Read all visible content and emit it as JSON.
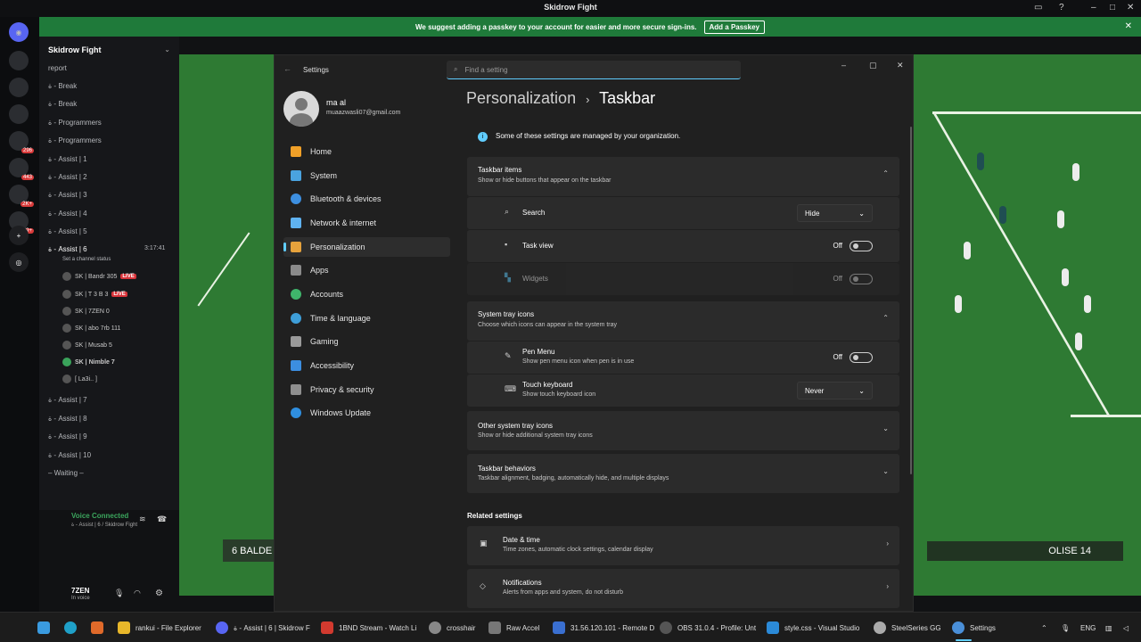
{
  "topbar": {
    "title": "Skidrow Fight"
  },
  "banner": {
    "text": "We suggest adding a passkey to your account for easier and more secure sign-ins.",
    "button": "Add a Passkey"
  },
  "servers": [
    {
      "badge": ""
    },
    {
      "badge": ""
    },
    {
      "badge": ""
    },
    {
      "badge": ""
    },
    {
      "badge": "296"
    },
    {
      "badge": "443"
    },
    {
      "badge": "2K+"
    },
    {
      "badge": "99+"
    }
  ],
  "channels": {
    "server_name": "Skidrow Fight",
    "items": [
      "report",
      "ة - Break",
      "ة - Break",
      "ة - Programmers",
      "ة - Programmers",
      "ة - Assist | 1",
      "ة - Assist | 2",
      "ة - Assist | 3",
      "ة - Assist | 4",
      "ة - Assist | 5"
    ],
    "active": {
      "label": "ة - Assist | 6",
      "time": "3:17:41",
      "status": "Set a channel status"
    },
    "voice_users": [
      {
        "name": "SK | Bandr 305",
        "live": "LIVE"
      },
      {
        "name": "SK | T 3 B 3",
        "live": "LIVE"
      },
      {
        "name": "SK | 7ZEN 0",
        "live": ""
      },
      {
        "name": "SK | abo 7rb 111",
        "live": ""
      },
      {
        "name": "SK | Musab 5",
        "live": ""
      },
      {
        "name": "SK | Nimble 7",
        "live": ""
      },
      {
        "name": "[ La3i.. ]",
        "live": ""
      }
    ],
    "more": [
      "ة - Assist | 7",
      "ة - Assist | 8",
      "ة - Assist | 9",
      "ة - Assist | 10",
      "– Waiting –"
    ]
  },
  "voice": {
    "status": "Voice Connected",
    "channel": "ة - Assist | 6 / Skidrow Fight",
    "user": "7ZEN",
    "user_status": "In voice"
  },
  "game": {
    "left_hud": "6  BALDE",
    "right_hud": "OLISE 14"
  },
  "settings": {
    "window_title": "Settings",
    "search_placeholder": "Find a setting",
    "profile": {
      "name": "ma al",
      "email": "muaazwasli07@gmail.com"
    },
    "nav": [
      {
        "label": "Home",
        "color": "#f0a028"
      },
      {
        "label": "System",
        "color": "#4aa3df"
      },
      {
        "label": "Bluetooth & devices",
        "color": "#3d8fe0"
      },
      {
        "label": "Network & internet",
        "color": "#5fb2f0"
      },
      {
        "label": "Personalization",
        "color": "#e6a23c"
      },
      {
        "label": "Apps",
        "color": "#8a8a8a"
      },
      {
        "label": "Accounts",
        "color": "#3fb56b"
      },
      {
        "label": "Time & language",
        "color": "#3e9ed8"
      },
      {
        "label": "Gaming",
        "color": "#9a9a9a"
      },
      {
        "label": "Accessibility",
        "color": "#3c8ee0"
      },
      {
        "label": "Privacy & security",
        "color": "#8f8f8f"
      },
      {
        "label": "Windows Update",
        "color": "#2f8fe0"
      }
    ],
    "breadcrumb": {
      "parent": "Personalization",
      "sep": "›",
      "current": "Taskbar"
    },
    "notice": "Some of these settings are managed by your organization.",
    "taskbar_items": {
      "title": "Taskbar items",
      "subtitle": "Show or hide buttons that appear on the taskbar",
      "search": {
        "label": "Search",
        "value": "Hide"
      },
      "taskview": {
        "label": "Task view",
        "value": "Off"
      },
      "widgets": {
        "label": "Widgets",
        "value": "Off"
      }
    },
    "tray": {
      "title": "System tray icons",
      "subtitle": "Choose which icons can appear in the system tray",
      "pen": {
        "label": "Pen Menu",
        "desc": "Show pen menu icon when pen is in use",
        "value": "Off"
      },
      "keyboard": {
        "label": "Touch keyboard",
        "desc": "Show touch keyboard icon",
        "value": "Never"
      }
    },
    "other_tray": {
      "title": "Other system tray icons",
      "subtitle": "Show or hide additional system tray icons"
    },
    "behaviors": {
      "title": "Taskbar behaviors",
      "subtitle": "Taskbar alignment, badging, automatically hide, and multiple displays"
    },
    "related": {
      "title": "Related settings",
      "date": {
        "label": "Date & time",
        "desc": "Time zones, automatic clock settings, calendar display"
      },
      "notif": {
        "label": "Notifications",
        "desc": "Alerts from apps and system, do not disturb"
      }
    }
  },
  "taskbar": {
    "apps": [
      {
        "label": "rankui - File Explorer",
        "color": "#e8b72a"
      },
      {
        "label": "ة - Assist | 6 | Skidrow F",
        "color": "#5865f2"
      },
      {
        "label": "1BND Stream - Watch Li",
        "color": "#d23a2f"
      },
      {
        "label": "crosshair",
        "color": "#888888"
      },
      {
        "label": "Raw Accel",
        "color": "#777777"
      },
      {
        "label": "31.56.120.101 - Remote D",
        "color": "#3a6fd0"
      },
      {
        "label": "OBS 31.0.4 - Profile: Unt",
        "color": "#555555"
      },
      {
        "label": "style.css - Visual Studio",
        "color": "#2b8ad8"
      },
      {
        "label": "SteelSeries GG",
        "color": "#aaaaaa"
      },
      {
        "label": "Settings",
        "color": "#4a8fd8"
      }
    ],
    "lang": "ENG"
  }
}
